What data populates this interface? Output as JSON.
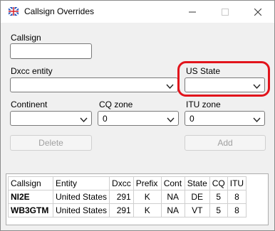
{
  "window": {
    "title": "Callsign Overrides",
    "icon": "app-logo-icon"
  },
  "form": {
    "callsign_label": "Callsign",
    "callsign_value": "",
    "dxcc_label": "Dxcc entity",
    "dxcc_value": "",
    "us_state_label": "US State",
    "us_state_value": "",
    "continent_label": "Continent",
    "continent_value": "",
    "cq_zone_label": "CQ zone",
    "cq_zone_value": "0",
    "itu_zone_label": "ITU zone",
    "itu_zone_value": "0",
    "delete_label": "Delete",
    "add_label": "Add",
    "highlight_color": "#e2141c"
  },
  "grid": {
    "columns": [
      "Callsign",
      "Entity",
      "Dxcc",
      "Prefix",
      "Cont",
      "State",
      "CQ",
      "ITU"
    ],
    "rows": [
      [
        "NI2E",
        "United States",
        "291",
        "K",
        "NA",
        "DE",
        "5",
        "8"
      ],
      [
        "WB3GTM",
        "United States",
        "291",
        "K",
        "NA",
        "VT",
        "5",
        "8"
      ]
    ]
  }
}
